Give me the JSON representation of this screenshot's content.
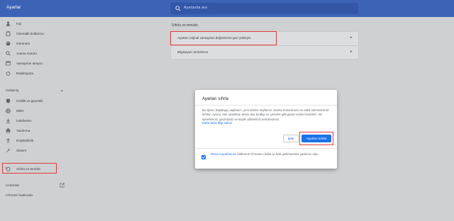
{
  "app": {
    "title": "Ayarlar"
  },
  "search": {
    "placeholder": "Ayarlarda ara"
  },
  "sidebar": {
    "items": [
      {
        "label": "Kişi",
        "icon": "person-icon"
      },
      {
        "label": "Otomatik doldurma",
        "icon": "clipboard-icon"
      },
      {
        "label": "Görünüm",
        "icon": "palette-icon"
      },
      {
        "label": "Arama motoru",
        "icon": "search-icon"
      },
      {
        "label": "Varsayılan tarayıcı",
        "icon": "browser-icon"
      },
      {
        "label": "Başlangıçta",
        "icon": "power-icon"
      }
    ],
    "advanced_label": "Gelişmiş",
    "advanced_items": [
      {
        "label": "Gizlilik ve güvenlik",
        "icon": "shield-icon"
      },
      {
        "label": "Diller",
        "icon": "globe-icon"
      },
      {
        "label": "İndirilenler",
        "icon": "download-icon"
      },
      {
        "label": "Yazdırma",
        "icon": "printer-icon"
      },
      {
        "label": "Erişilebilirlik",
        "icon": "accessibility-icon"
      },
      {
        "label": "Sistem",
        "icon": "wrench-icon"
      },
      {
        "label": "Sıfırla ve temizle",
        "icon": "reset-icon"
      }
    ],
    "extensions_label": "Uzantılar",
    "about_label": "Chrome hakkında"
  },
  "main": {
    "section_title": "Sıfırla ve temizle",
    "rows": [
      {
        "label": "Ayarları orijinal varsayılan değerlerine geri yükleyin"
      },
      {
        "label": "Bilgisayarı temizleme"
      }
    ]
  },
  "dialog": {
    "title": "Ayarları sıfırla",
    "body": "Bu işlem, başlangıç sayfanızı, yeni sekme sayfanızı, arama motorunuzu ve sabit sekmelerinizi sıfırlar. Ayrıca, tüm uzantıları devre dışı bırakıp ve çerezler gibi geçici verileri temizler. Yer işaretleriniz, geçmişiniz ve kayıtlı şifreleriniz temizlenmez.",
    "learn_more": "Daha fazla bilgi edinin",
    "cancel_label": "İptal",
    "reset_label": "Ayarları sıfırla",
    "footer_link": "Mevcut ayarlarınızı",
    "footer_text": "bildirerek Chrome'u daha iyi hale getirmemize yardımcı olun"
  },
  "colors": {
    "topbar": "#3c63b6",
    "accent": "#1a73e8",
    "highlight": "#e23b3b"
  }
}
